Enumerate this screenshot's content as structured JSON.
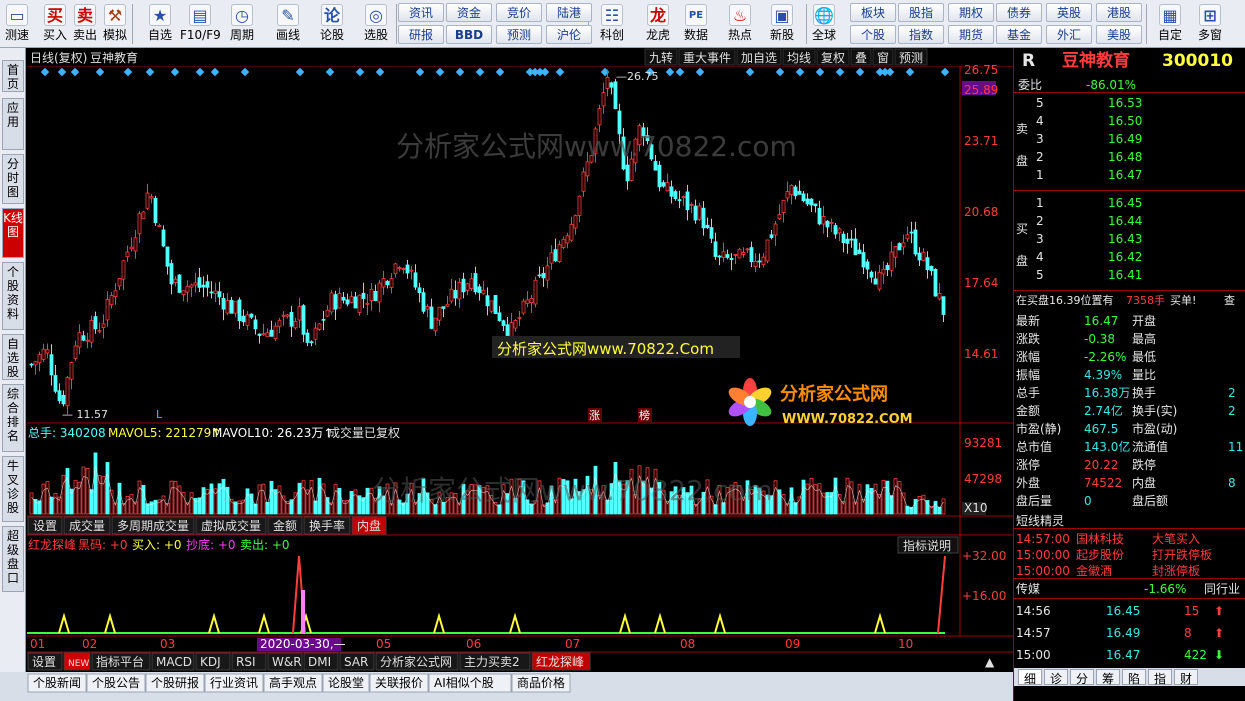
{
  "toolbar": {
    "buttons": [
      {
        "label": "测速",
        "icon": "monitor-icon"
      },
      {
        "label": "买入",
        "icon": "buy-icon",
        "glyph": "买"
      },
      {
        "label": "卖出",
        "icon": "sell-icon",
        "glyph": "卖"
      },
      {
        "label": "模拟",
        "icon": "hammer-icon",
        "glyph": "⚒"
      },
      {
        "label": "自选",
        "icon": "star-icon",
        "glyph": "★"
      },
      {
        "label": "F10/F9",
        "icon": "f10-icon",
        "glyph": "▤"
      },
      {
        "label": "周期",
        "icon": "clock-icon",
        "glyph": "◷"
      },
      {
        "label": "画线",
        "icon": "pencil-icon",
        "glyph": "✎"
      },
      {
        "label": "论股",
        "icon": "forum-icon",
        "glyph": "论"
      },
      {
        "label": "选股",
        "icon": "select-stock-icon",
        "glyph": "◎"
      },
      {
        "label": "科创",
        "icon": "kechuang-icon",
        "glyph": "☷"
      },
      {
        "label": "龙虎",
        "icon": "dragon-tiger-icon",
        "glyph": "龙"
      },
      {
        "label": "数据",
        "icon": "pe-data-icon",
        "glyph": "PE"
      },
      {
        "label": "热点",
        "icon": "hot-icon",
        "glyph": "♨"
      },
      {
        "label": "新股",
        "icon": "new-stock-icon",
        "glyph": "▣"
      },
      {
        "label": "全球",
        "icon": "globe-icon",
        "glyph": "🌐"
      },
      {
        "label": "自定",
        "icon": "custom-icon",
        "glyph": "▦"
      },
      {
        "label": "多窗",
        "icon": "multi-window-icon",
        "glyph": "⊞"
      }
    ],
    "quick_row1": [
      "资讯",
      "资金",
      "竞价",
      "陆港"
    ],
    "quick_row2": [
      "研报",
      "BBD",
      "预测",
      "沪伦"
    ],
    "quick_row3": [
      "板块",
      "股指",
      "期权",
      "债券",
      "英股",
      "港股"
    ],
    "quick_row4": [
      "个股",
      "指数",
      "期货",
      "基金",
      "外汇",
      "美股"
    ]
  },
  "sidebar": [
    "首页",
    "应用",
    "分时图",
    "K线图",
    "个股资料",
    "自选股",
    "综合排名",
    "牛叉诊股",
    "超级盘口"
  ],
  "chart_header": {
    "period": "日线(复权)",
    "name": "豆神教育",
    "menu": [
      "九转",
      "重大事件",
      "加自选",
      "均线",
      "复权",
      "叠",
      "窗",
      "预测"
    ]
  },
  "price_axis": {
    "labels": [
      "26.75",
      "25.89",
      "23.71",
      "20.68",
      "17.64",
      "14.61"
    ]
  },
  "annotations": {
    "high": "26.75",
    "low": "11.57",
    "marker_l": "L",
    "tag1": "涨",
    "tag2": "榜"
  },
  "watermark": {
    "text1": "分析家公式网www.70822.com",
    "text2": "分析家公式网www.70822.Com",
    "logo_cn": "分析家公式网",
    "logo_url": "WWW.70822.COM"
  },
  "volume_header": {
    "total": "总手: 340208",
    "ma5": "MAVOL5: 221279",
    "ma10": "MAVOL10: 26.23万",
    "note": "成交量已复权"
  },
  "volume_axis": {
    "labels": [
      "93281",
      "47298",
      "X10"
    ]
  },
  "volume_tabs": [
    "设置",
    "成交量",
    "多周期成交量",
    "虚拟成交量",
    "金额",
    "换手率",
    "内盘"
  ],
  "indicator_header": {
    "name": "红龙探峰",
    "items": [
      "黑码: +0",
      "买入: +0",
      "抄底: +0",
      "卖出: +0"
    ],
    "help": "指标说明"
  },
  "indicator_axis": {
    "labels": [
      "+32.00",
      "+16.00"
    ]
  },
  "date_axis": {
    "labels": [
      "01",
      "02",
      "03",
      "2020-03-30,—",
      "05",
      "06",
      "07",
      "08",
      "09",
      "10"
    ]
  },
  "indicator_tabs": [
    "设置",
    "NEW",
    "指标平台",
    "MACD",
    "KDJ",
    "RSI",
    "W&R",
    "DMI",
    "SAR",
    "分析家公式网",
    "主力买卖2",
    "红龙探峰"
  ],
  "bottom_tabs": [
    "个股新闻",
    "个股公告",
    "个股研报",
    "行业资讯",
    "高手观点",
    "论股堂",
    "关联报价",
    "AI相似个股",
    "商品价格"
  ],
  "quote": {
    "name": "豆神教育",
    "code": "300010",
    "mark": "R",
    "weibi_label": "委比",
    "weibi": "-86.01%",
    "sell_label": [
      "卖",
      "盘"
    ],
    "buy_label": [
      "买",
      "盘"
    ],
    "sells": [
      [
        "5",
        "16.53"
      ],
      [
        "4",
        "16.50"
      ],
      [
        "3",
        "16.49"
      ],
      [
        "2",
        "16.48"
      ],
      [
        "1",
        "16.47"
      ]
    ],
    "buys": [
      [
        "1",
        "16.45"
      ],
      [
        "2",
        "16.44"
      ],
      [
        "3",
        "16.43"
      ],
      [
        "4",
        "16.42"
      ],
      [
        "5",
        "16.41"
      ]
    ],
    "info_line": "在买盘16.39位置有",
    "info_qty": "7358手",
    "info_act": "买单!",
    "info_more": "查",
    "stats": [
      [
        "最新",
        "16.47",
        "开盘",
        ""
      ],
      [
        "涨跌",
        "-0.38",
        "最高",
        ""
      ],
      [
        "涨幅",
        "-2.26%",
        "最低",
        ""
      ],
      [
        "振幅",
        "4.39%",
        "量比",
        ""
      ],
      [
        "总手",
        "16.38万",
        "换手",
        "2"
      ],
      [
        "金额",
        "2.74亿",
        "换手(实)",
        "2"
      ],
      [
        "市盈(静)",
        "467.5",
        "市盈(动)",
        ""
      ],
      [
        "总市值",
        "143.0亿",
        "流通值",
        "11"
      ],
      [
        "涨停",
        "20.22",
        "跌停",
        ""
      ],
      [
        "外盘",
        "74522",
        "内盘",
        "8"
      ],
      [
        "盘后量",
        "0",
        "盘后额",
        ""
      ]
    ],
    "news_title": "短线精灵",
    "news": [
      [
        "14:57:00",
        "国林科技",
        "大笔买入"
      ],
      [
        "15:00:00",
        "起步股份",
        "打开跌停板"
      ],
      [
        "15:00:00",
        "金徽酒",
        "封涨停板"
      ]
    ],
    "sector": "传媒",
    "sector_pct": "-1.66%",
    "sector_btn": "同行业",
    "ticks": [
      [
        "14:56",
        "16.45",
        "15",
        "up"
      ],
      [
        "14:57",
        "16.49",
        "8",
        "up"
      ],
      [
        "15:00",
        "16.47",
        "422",
        "down"
      ]
    ],
    "tabs": [
      "细",
      "诊",
      "分",
      "筹",
      "陷",
      "指",
      "财"
    ]
  },
  "colors": {
    "up": "#ff3c3c",
    "down": "#54ffff",
    "bg": "#000000",
    "grid": "#a00000"
  }
}
